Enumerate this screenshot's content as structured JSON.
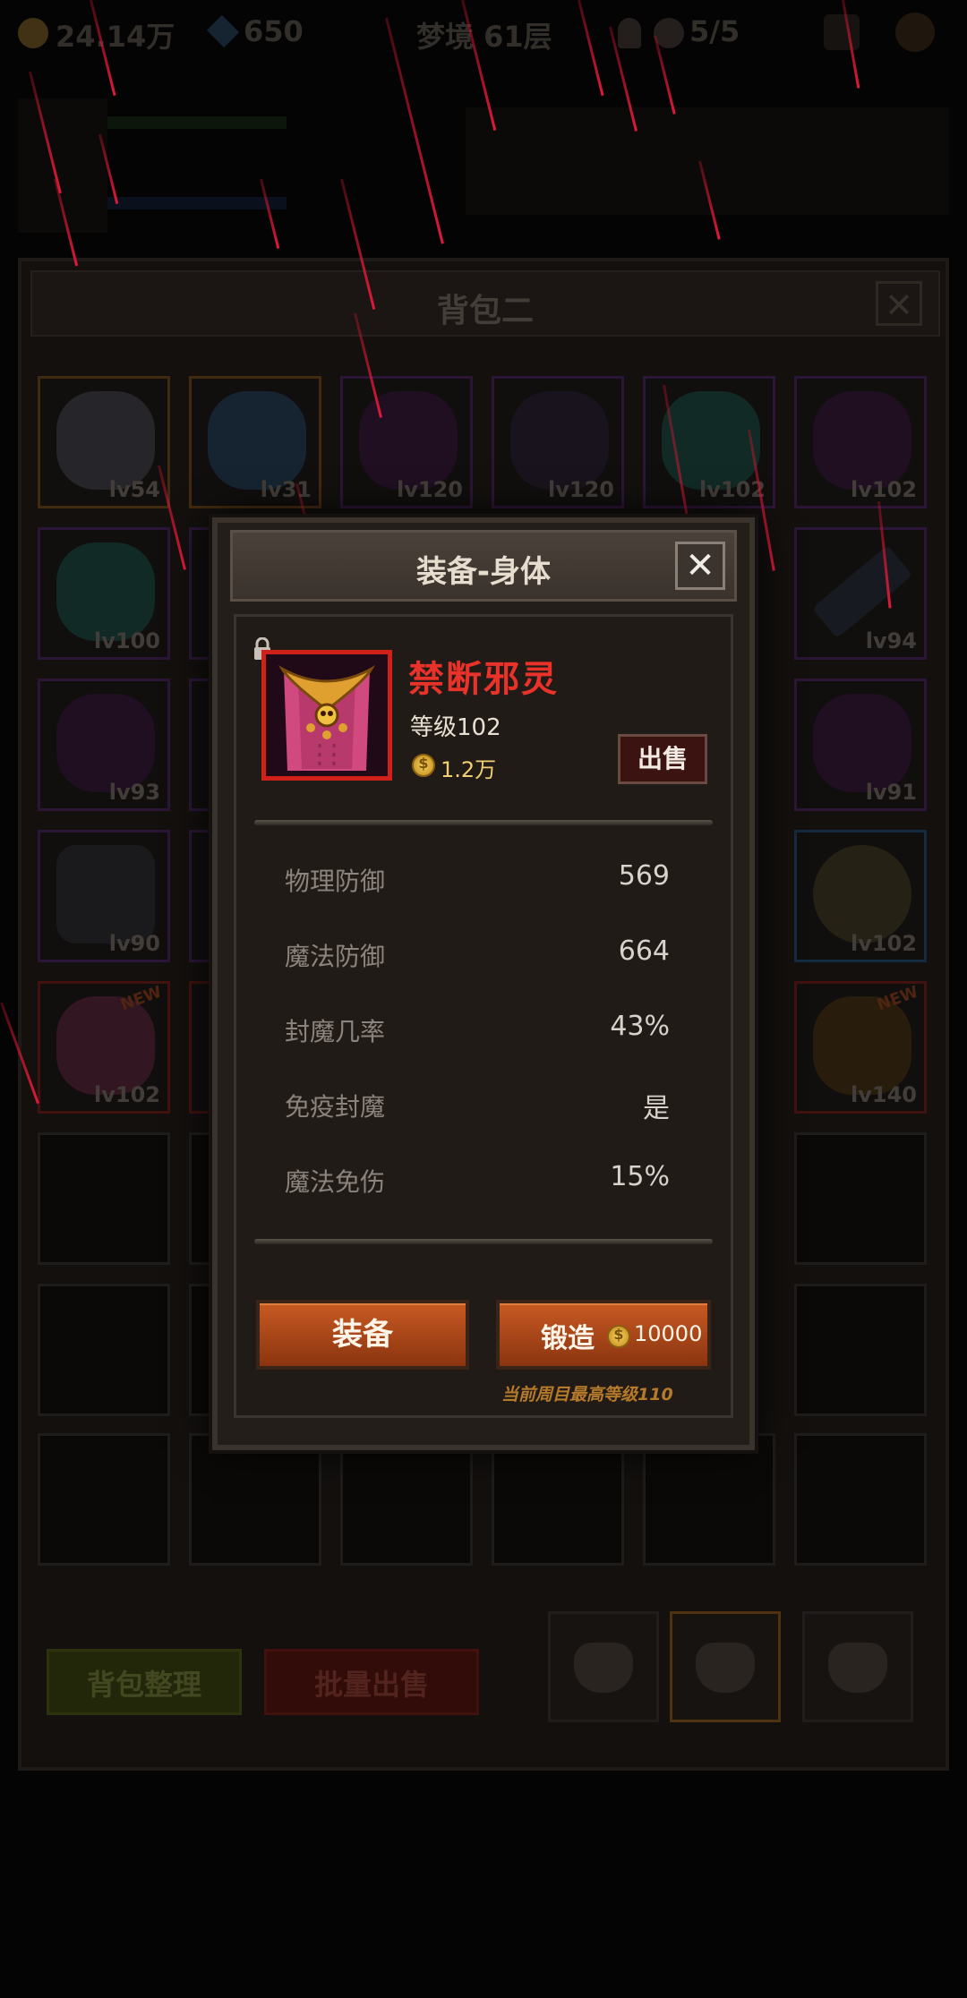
{
  "hud": {
    "gold": "24.14万",
    "gems": "650",
    "floor": "梦境 61层",
    "lives": "5/5"
  },
  "bag": {
    "title": "背包二",
    "close_label": "✕",
    "items": [
      {
        "level": "lv54",
        "rarity": "orange",
        "badge": ""
      },
      {
        "level": "lv31",
        "rarity": "orange",
        "badge": ""
      },
      {
        "level": "lv120",
        "rarity": "purple",
        "badge": ""
      },
      {
        "level": "lv120",
        "rarity": "purple",
        "badge": ""
      },
      {
        "level": "lv102",
        "rarity": "purple",
        "badge": ""
      },
      {
        "level": "lv102",
        "rarity": "purple",
        "badge": ""
      },
      {
        "level": "lv100",
        "rarity": "purple",
        "badge": ""
      },
      {
        "level": "lv94",
        "rarity": "purple",
        "badge": ""
      },
      {
        "level": "lv93",
        "rarity": "purple",
        "badge": ""
      },
      {
        "level": "lv91",
        "rarity": "purple",
        "badge": ""
      },
      {
        "level": "lv90",
        "rarity": "purple",
        "badge": ""
      },
      {
        "level": "lv102",
        "rarity": "blue",
        "badge": ""
      },
      {
        "level": "lv102",
        "rarity": "red",
        "badge": "NEW"
      },
      {
        "level": "lv140",
        "rarity": "red",
        "badge": "NEW"
      }
    ],
    "sort_label": "背包整理",
    "bulk_sell_label": "批量出售"
  },
  "dialog": {
    "title": "装备-身体",
    "close_label": "✕",
    "item_name": "禁断邪灵",
    "item_level": "等级102",
    "price": "1.2万",
    "sell_label": "出售",
    "stats": [
      {
        "label": "物理防御",
        "value": "569"
      },
      {
        "label": "魔法防御",
        "value": "664"
      },
      {
        "label": "封魔几率",
        "value": "43%"
      },
      {
        "label": "免疫封魔",
        "value": "是"
      },
      {
        "label": "魔法免伤",
        "value": "15%"
      }
    ],
    "equip_label": "装备",
    "forge_label": "锻造",
    "forge_cost": "10000",
    "max_level_note": "当前周目最高等级110"
  },
  "colors": {
    "item_name": "#e8322a",
    "action_button": "#b84a18",
    "coin": "#e0b030"
  },
  "icons": [
    "coin-icon",
    "gem-icon",
    "key-icon",
    "skull-icon",
    "lock-icon",
    "close-icon",
    "bag-tab-icon"
  ]
}
